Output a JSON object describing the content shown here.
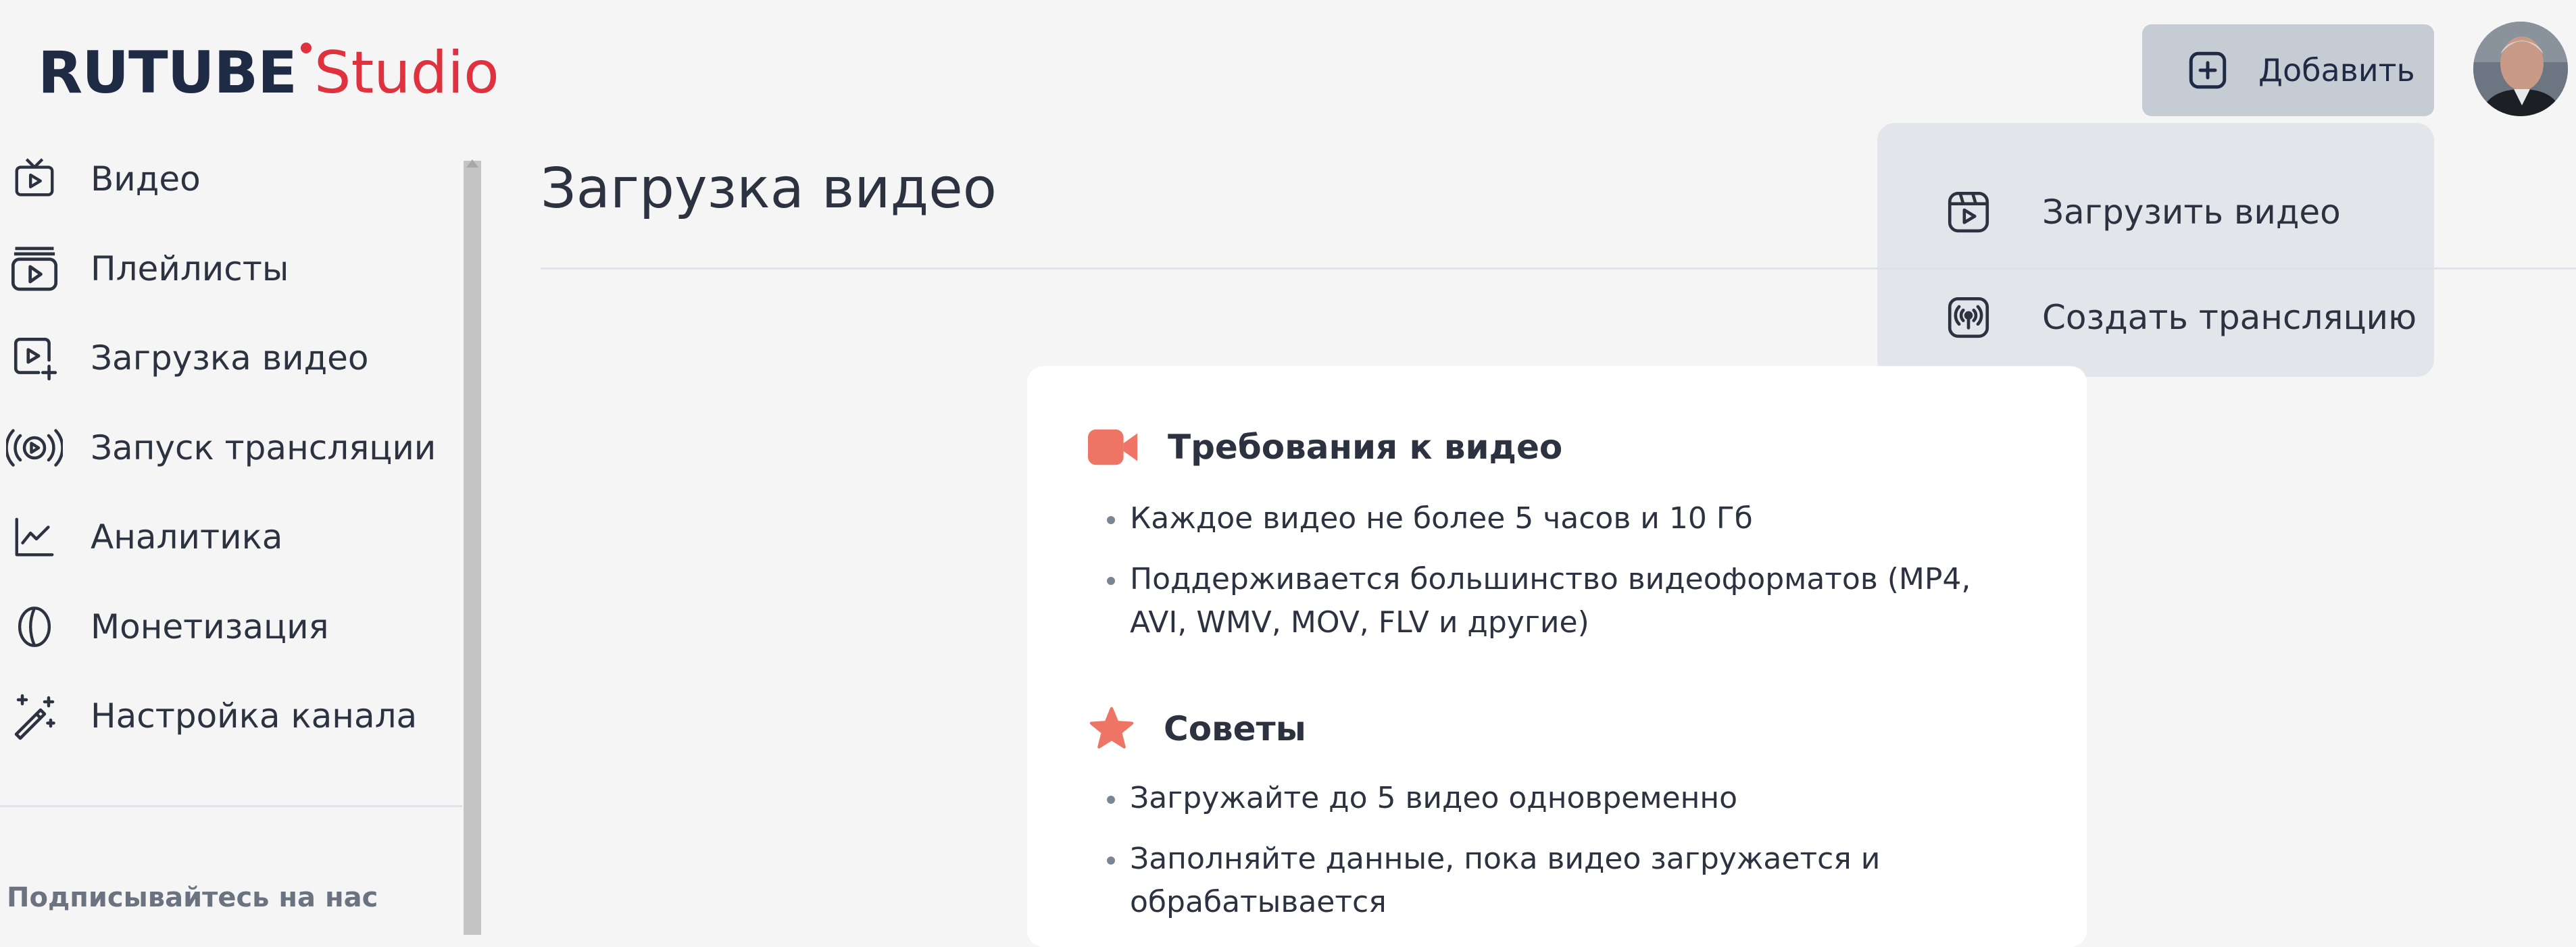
{
  "header": {
    "logo_main": "RUTUBE",
    "logo_studio": "Studio",
    "add_button_label": "Добавить"
  },
  "dropdown": {
    "items": [
      {
        "label": "Загрузить видео",
        "icon": "upload-video-icon"
      },
      {
        "label": "Создать трансляцию",
        "icon": "broadcast-icon"
      }
    ]
  },
  "sidebar": {
    "items": [
      {
        "label": "Видео",
        "icon": "tv-play-icon"
      },
      {
        "label": "Плейлисты",
        "icon": "playlist-icon"
      },
      {
        "label": "Загрузка видео",
        "icon": "video-add-icon"
      },
      {
        "label": "Запуск трансляции",
        "icon": "live-broadcast-icon"
      },
      {
        "label": "Аналитика",
        "icon": "chart-line-icon"
      },
      {
        "label": "Монетизация",
        "icon": "coin-icon"
      },
      {
        "label": "Настройка канала",
        "icon": "magic-wand-icon"
      }
    ],
    "follow_label": "Подписывайтесь на нас"
  },
  "main": {
    "title": "Загрузка видео",
    "requirements": {
      "heading": "Требования к видео",
      "items": [
        "Каждое видео не более 5 часов и 10 Гб",
        "Поддерживается большинство видеоформатов (MP4, AVI, WMV, MOV, FLV и другие)"
      ]
    },
    "tips": {
      "heading": "Советы",
      "items": [
        "Загружайте до 5 видео одновременно",
        "Заполняйте данные, пока видео загружается и обрабатывается"
      ]
    }
  },
  "colors": {
    "brand_dark": "#1f2a44",
    "brand_red": "#e0323e",
    "accent_coral": "#ee7566",
    "button_bg": "#c5ccd4",
    "dropdown_bg": "#e2e6eb"
  }
}
